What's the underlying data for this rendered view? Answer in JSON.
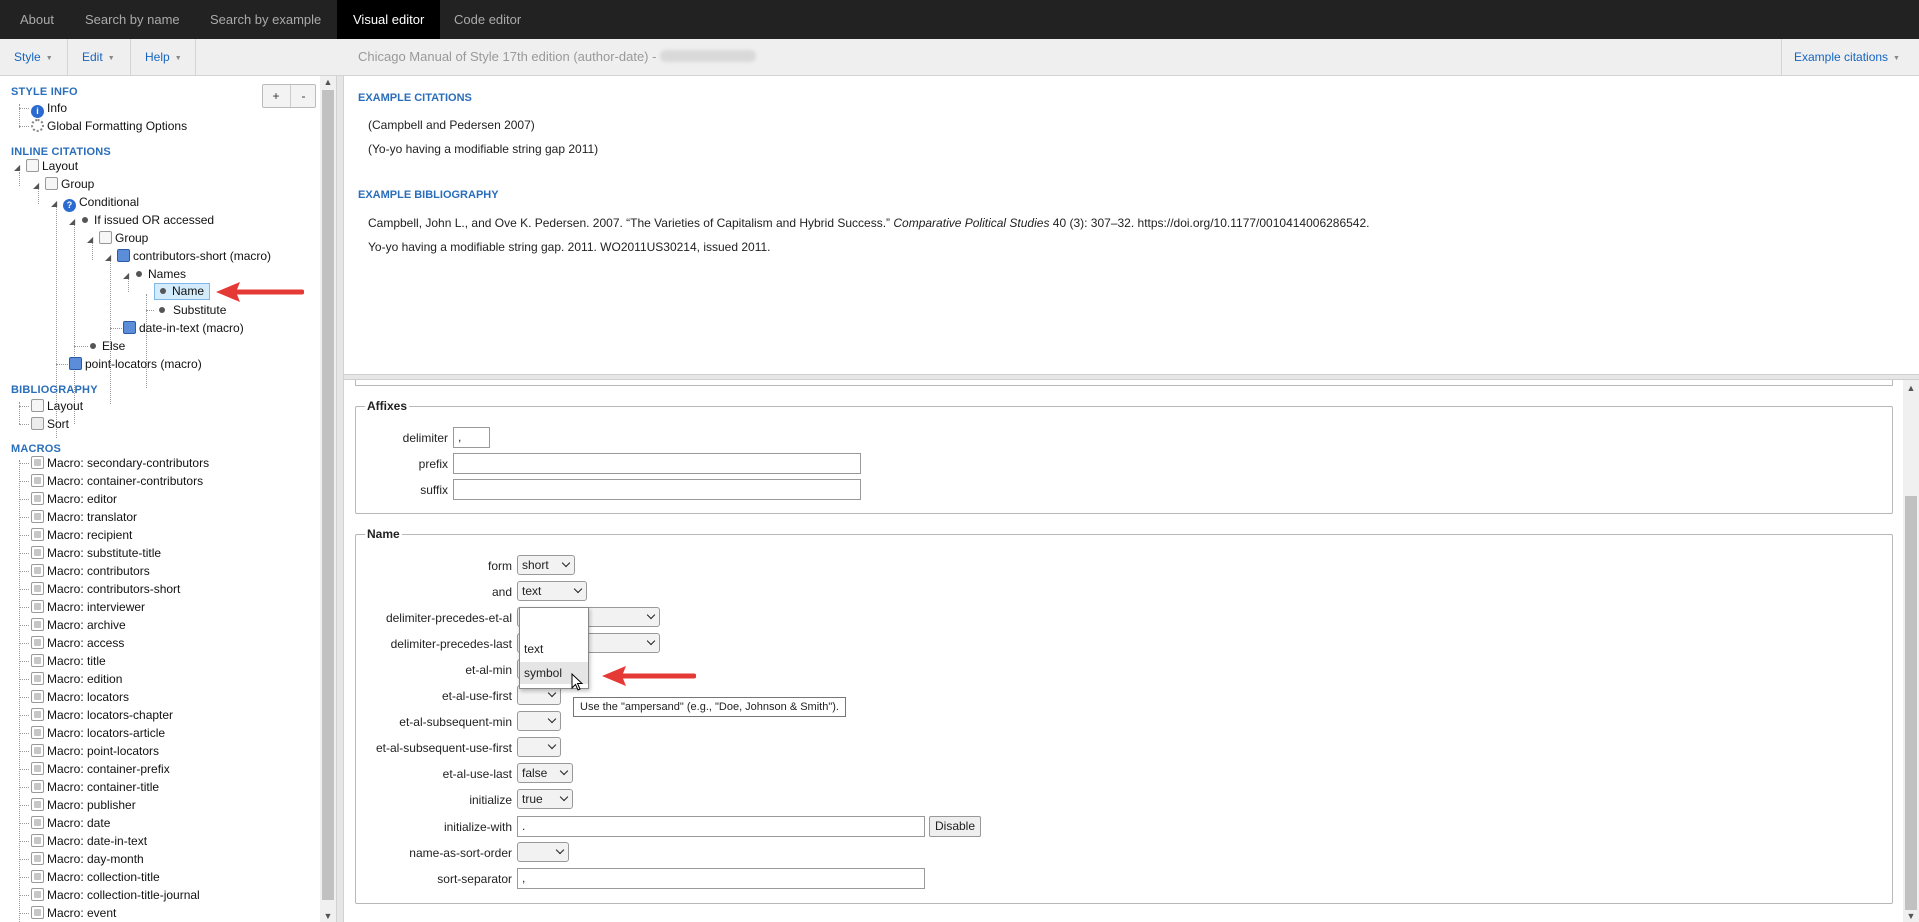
{
  "topnav": {
    "tabs": [
      "About",
      "Search by name",
      "Search by example",
      "Visual editor",
      "Code editor"
    ],
    "active": "Visual editor"
  },
  "menubar": {
    "style": "Style",
    "edit": "Edit",
    "help": "Help",
    "style_title": "Chicago Manual of Style 17th edition (author-date) -",
    "example_citations": "Example citations"
  },
  "tree": {
    "plus": "+",
    "minus": "-",
    "style_info": "STYLE INFO",
    "info": "Info",
    "global_formatting": "Global Formatting Options",
    "inline_citations": "INLINE CITATIONS",
    "layout": "Layout",
    "group": "Group",
    "conditional": "Conditional",
    "if_issued": "If issued OR accessed",
    "group2": "Group",
    "contributors_short": "contributors-short (macro)",
    "names": "Names",
    "name": "Name",
    "substitute": "Substitute",
    "date_in_text": "date-in-text (macro)",
    "else": "Else",
    "point_locators": "point-locators (macro)",
    "bibliography": "BIBLIOGRAPHY",
    "bib_layout": "Layout",
    "bib_sort": "Sort",
    "macros_header": "MACROS",
    "macros": [
      "Macro: secondary-contributors",
      "Macro: container-contributors",
      "Macro: editor",
      "Macro: translator",
      "Macro: recipient",
      "Macro: substitute-title",
      "Macro: contributors",
      "Macro: contributors-short",
      "Macro: interviewer",
      "Macro: archive",
      "Macro: access",
      "Macro: title",
      "Macro: edition",
      "Macro: locators",
      "Macro: locators-chapter",
      "Macro: locators-article",
      "Macro: point-locators",
      "Macro: container-prefix",
      "Macro: container-title",
      "Macro: publisher",
      "Macro: date",
      "Macro: date-in-text",
      "Macro: day-month",
      "Macro: collection-title",
      "Macro: collection-title-journal",
      "Macro: event"
    ]
  },
  "examples": {
    "citations_header": "EXAMPLE CITATIONS",
    "citations": [
      "(Campbell and Pedersen 2007)",
      "(Yo-yo having a modifiable string gap 2011)"
    ],
    "bibliography_header": "EXAMPLE BIBLIOGRAPHY",
    "bib1_pre": "Campbell, John L., and Ove K. Pedersen. 2007. “The Varieties of Capitalism and Hybrid Success.” ",
    "bib1_italic": "Comparative Political Studies",
    "bib1_post": " 40 (3): 307–32. https://doi.org/10.1177/0010414006286542.",
    "bib2": "Yo-yo having a modifiable string gap. 2011. WO2011US30214, issued 2011."
  },
  "affixes": {
    "legend": "Affixes",
    "delimiter_label": "delimiter",
    "delimiter_value": ",",
    "prefix_label": "prefix",
    "prefix_value": "",
    "suffix_label": "suffix",
    "suffix_value": ""
  },
  "name_section": {
    "legend": "Name",
    "form_label": "form",
    "form_value": "short",
    "and_label": "and",
    "and_value": "text",
    "dpea_label": "delimiter-precedes-et-al",
    "dpl_label": "delimiter-precedes-last",
    "et_al_min_label": "et-al-min",
    "et_al_use_first_label": "et-al-use-first",
    "et_al_subsequent_min_label": "et-al-subsequent-min",
    "et_al_subsequent_use_first_label": "et-al-subsequent-use-first",
    "et_al_use_last_label": "et-al-use-last",
    "et_al_use_last_value": "false",
    "initialize_label": "initialize",
    "initialize_value": "true",
    "initialize_with_label": "initialize-with",
    "initialize_with_value": ".",
    "disable_label": "Disable",
    "name_as_sort_order_label": "name-as-sort-order",
    "sort_separator_label": "sort-separator",
    "sort_separator_value": ","
  },
  "dropdown": {
    "options": [
      "",
      "text",
      "symbol"
    ],
    "highlighted": "symbol"
  },
  "tooltip": "Use the \"ampersand\" (e.g., \"Doe, Johnson & Smith\").",
  "colors": {
    "link": "#1565c0",
    "section": "#2a6ebb",
    "arrow": "#e53935"
  }
}
